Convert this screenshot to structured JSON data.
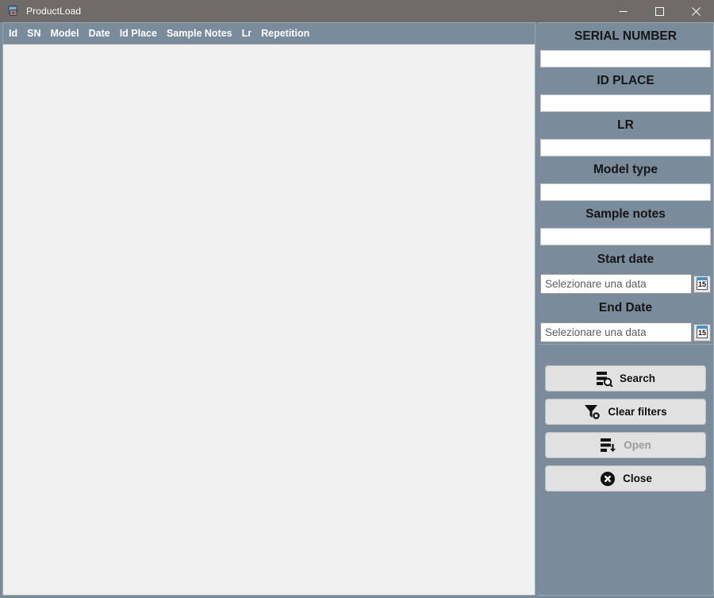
{
  "window": {
    "title": "ProductLoad",
    "app_icon": "application-window-icon",
    "controls": {
      "minimize": "minimize-icon",
      "maximize": "maximize-icon",
      "close": "close-icon"
    }
  },
  "colors": {
    "titlebar": "#6e6b68",
    "panel": "#7a8b9c",
    "grid_header": "#7a8b9c",
    "grid_body": "#f0f0f0",
    "button_face": "#e1e1e1",
    "calendar_accent": "#4a90c4"
  },
  "grid": {
    "columns": [
      "Id",
      "SN",
      "Model",
      "Date",
      "Id Place",
      "Sample Notes",
      "Lr",
      "Repetition"
    ],
    "rows": []
  },
  "filters": [
    {
      "label": "SERIAL NUMBER",
      "value": "",
      "name": "serial-number"
    },
    {
      "label": "ID PLACE",
      "value": "",
      "name": "id-place"
    },
    {
      "label": "LR",
      "value": "",
      "name": "lr"
    },
    {
      "label": "Model type",
      "value": "",
      "name": "model-type"
    },
    {
      "label": "Sample notes",
      "value": "",
      "name": "sample-notes"
    }
  ],
  "dates": [
    {
      "label": "Start date",
      "placeholder": "Selezionare una data",
      "value": "",
      "calendar_day": "15"
    },
    {
      "label": "End Date",
      "placeholder": "Selezionare una data",
      "value": "",
      "calendar_day": "15"
    }
  ],
  "buttons": [
    {
      "label": "Search",
      "icon": "list-search-icon",
      "disabled": false
    },
    {
      "label": "Clear filters",
      "icon": "funnel-clear-icon",
      "disabled": false
    },
    {
      "label": "Open",
      "icon": "list-download-icon",
      "disabled": true
    },
    {
      "label": "Close",
      "icon": "circle-x-icon",
      "disabled": false
    }
  ]
}
